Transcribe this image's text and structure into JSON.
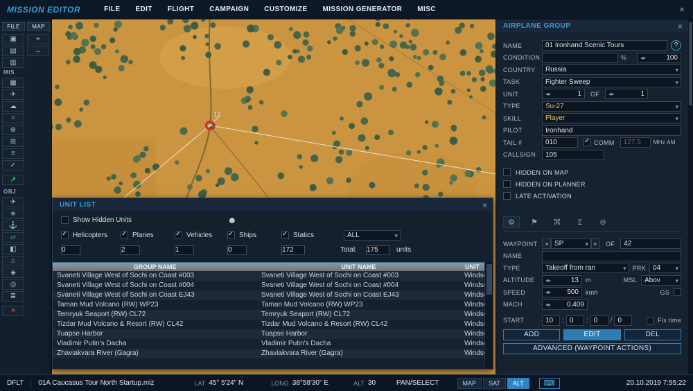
{
  "ui": {
    "caret": "▾",
    "left": "◂",
    "right": "▸",
    "check": "✓"
  },
  "titlebar": {
    "title": "MISSION EDITOR",
    "menu": [
      "FILE",
      "EDIT",
      "FLIGHT",
      "CAMPAIGN",
      "CUSTOMIZE",
      "MISSION GENERATOR",
      "MISC"
    ],
    "close_glyph": "×"
  },
  "sidebar": {
    "tabs": [
      {
        "label": "FILE"
      },
      {
        "label": "MAP"
      }
    ],
    "file_tools": [
      {
        "name": "open-mission",
        "glyph": "▣"
      },
      {
        "name": "save-mission",
        "glyph": "▤"
      },
      {
        "name": "export-mission",
        "glyph": "▥"
      }
    ],
    "map_tools": [
      {
        "name": "map-options",
        "glyph": "⌖"
      },
      {
        "name": "measure-distance",
        "glyph": "↔"
      }
    ],
    "mis_label": "MIS",
    "mis_tools": [
      {
        "name": "mission-options",
        "glyph": "▦"
      },
      {
        "name": "aircraft-pool",
        "glyph": "✈"
      },
      {
        "name": "weather-editor",
        "glyph": "☁"
      },
      {
        "name": "sea-state",
        "glyph": "≈"
      },
      {
        "name": "targeting-options",
        "glyph": "⊕"
      },
      {
        "name": "trigger-zones",
        "glyph": "⊞"
      },
      {
        "name": "mission-settings",
        "glyph": "≡"
      },
      {
        "name": "validate-mission",
        "glyph": "✓"
      }
    ],
    "fly_tool": {
      "name": "fly-mission",
      "glyph": "↗"
    },
    "obj_label": "OBJ",
    "obj_tools": [
      {
        "name": "add-airplane",
        "glyph": "✈"
      },
      {
        "name": "add-helicopter",
        "glyph": "∗"
      },
      {
        "name": "add-ship",
        "glyph": "⚓"
      },
      {
        "name": "add-vehicle",
        "glyph": "▱"
      },
      {
        "name": "add-static",
        "glyph": "◧"
      },
      {
        "name": "add-building",
        "glyph": "⌂"
      },
      {
        "name": "add-template",
        "glyph": "◈"
      },
      {
        "name": "add-trigger-zone",
        "glyph": "◎"
      },
      {
        "name": "object-list",
        "glyph": "≣"
      }
    ],
    "delete_tool": {
      "name": "delete-object",
      "glyph": "×"
    }
  },
  "map": {
    "waypoint_label": "17"
  },
  "airplane_group": {
    "title": "AIRPLANE GROUP",
    "close_glyph": "×",
    "help_glyph": "?",
    "labels": {
      "name": "NAME",
      "condition": "CONDITION",
      "percent": "%",
      "country": "COUNTRY",
      "task": "TASK",
      "unit": "UNIT",
      "of": "OF",
      "type": "TYPE",
      "skill": "SKILL",
      "pilot": "PILOT",
      "tail": "TAIL #",
      "comm": "COMM",
      "freq_unit": "MHz AM",
      "callsign": "CALLSIGN"
    },
    "values": {
      "name": "01 Ironhand Scenic Tours",
      "condition": "",
      "condition_prob": "100",
      "country": "Russia",
      "task": "Fighter Sweep",
      "unit_index": "1",
      "unit_count": "1",
      "type": "Su-27",
      "skill": "Player",
      "pilot": "Ironhand",
      "tail": "010",
      "freq": "127.5",
      "callsign": "105"
    },
    "checkboxes": [
      {
        "label": "HIDDEN ON MAP"
      },
      {
        "label": "HIDDEN ON PLANNER"
      },
      {
        "label": "LATE ACTIVATION"
      }
    ]
  },
  "waypoint_panel": {
    "tabs": [
      {
        "name": "route-tab",
        "glyph": "⚙"
      },
      {
        "name": "payload-tab",
        "glyph": "⚑"
      },
      {
        "name": "actions-tab",
        "glyph": "⌘"
      },
      {
        "name": "summary-tab",
        "glyph": "Σ"
      },
      {
        "name": "failures-tab",
        "glyph": "⊘"
      }
    ],
    "labels": {
      "waypoint": "WAYPOINT",
      "of": "OF",
      "name": "NAME",
      "type": "TYPE",
      "prk": "PRK",
      "altitude": "ALTITUDE",
      "alt_unit": "m",
      "msl": "MSL",
      "speed": "SPEED",
      "speed_unit": "kmh",
      "gs": "GS",
      "mach": "MACH",
      "start": "START",
      "fix_time": "Fix time",
      "sep_colon": ":",
      "sep_slash": "/"
    },
    "values": {
      "waypoint": "SP",
      "wp_total": "42",
      "name": "",
      "type": "Takeoff from ran",
      "prk": "04",
      "altitude": "13",
      "alt_ref": "Abov",
      "speed": "500",
      "mach": "0.409",
      "start_h": "10",
      "start_m": "0",
      "start_s": "0",
      "start_d": "0"
    },
    "buttons": {
      "add": "ADD",
      "edit": "EDIT",
      "del": "DEL",
      "advanced": "ADVANCED (WAYPOINT ACTIONS)"
    }
  },
  "unit_list": {
    "title": "UNIT LIST",
    "close_glyph": "×",
    "show_hidden_label": "Show Hidden Units",
    "person_glyph": "☻",
    "filters": [
      {
        "label": "Helicopters",
        "count": "0"
      },
      {
        "label": "Planes",
        "count": "2"
      },
      {
        "label": "Vehicles",
        "count": "1"
      },
      {
        "label": "Ships",
        "count": "0"
      },
      {
        "label": "Statics",
        "count": "172"
      }
    ],
    "coalition": "ALL",
    "total_label": "Total:",
    "total": "175",
    "units_label": "units",
    "columns": [
      "GROUP NAME",
      "UNIT NAME",
      "UNIT"
    ],
    "rows": [
      {
        "group": "Svaneti Village West of Sochi on Coast #003",
        "unit": "Svaneti Village West of Sochi on Coast #003",
        "type": "Windso"
      },
      {
        "group": "Svaneti Village West of Sochi on Coast #004",
        "unit": "Svaneti Village West of Sochi on Coast #004",
        "type": "Windso"
      },
      {
        "group": "Svaneti Village West of Sochi on Coast EJ43",
        "unit": "Svaneti Village West of Sochi on Coast EJ43",
        "type": "Windso"
      },
      {
        "group": "Taman Mud Volcano (RW) WP23",
        "unit": "Taman Mud Volcano (RW) WP23",
        "type": "Windso"
      },
      {
        "group": "Temryuk Seaport (RW) CL72",
        "unit": "Temryuk Seaport (RW) CL72",
        "type": "Windso"
      },
      {
        "group": "Tizdar Mud Volcano & Resort (RW) CL42",
        "unit": "Tizdar Mud Volcano & Resort (RW) CL42",
        "type": "Windso"
      },
      {
        "group": "Tuapse Harbor",
        "unit": "Tuapse Harbor",
        "type": "Windso"
      },
      {
        "group": "Vladimir Putin's Dacha",
        "unit": "Vladimir Putin's Dacha",
        "type": "Windso"
      },
      {
        "group": "Zhaviakvara River (Gagra)",
        "unit": "Zhaviakvara River (Gagra)",
        "type": "Windso"
      }
    ]
  },
  "statusbar": {
    "mode": "DFLT",
    "file": "01A Caucasus Tour North Startup.miz",
    "lat_label": "LAT",
    "lat": "45° 5'24\" N",
    "long_label": "LONG",
    "long": "38°58'30\" E",
    "alt_label": "ALT",
    "alt": "30",
    "tool": "PAN/SELECT",
    "layers": [
      {
        "label": "MAP"
      },
      {
        "label": "SAT"
      },
      {
        "label": "ALT"
      }
    ],
    "keyboard_glyph": "⌨",
    "datetime": "20.10.2019 7:55:22"
  }
}
